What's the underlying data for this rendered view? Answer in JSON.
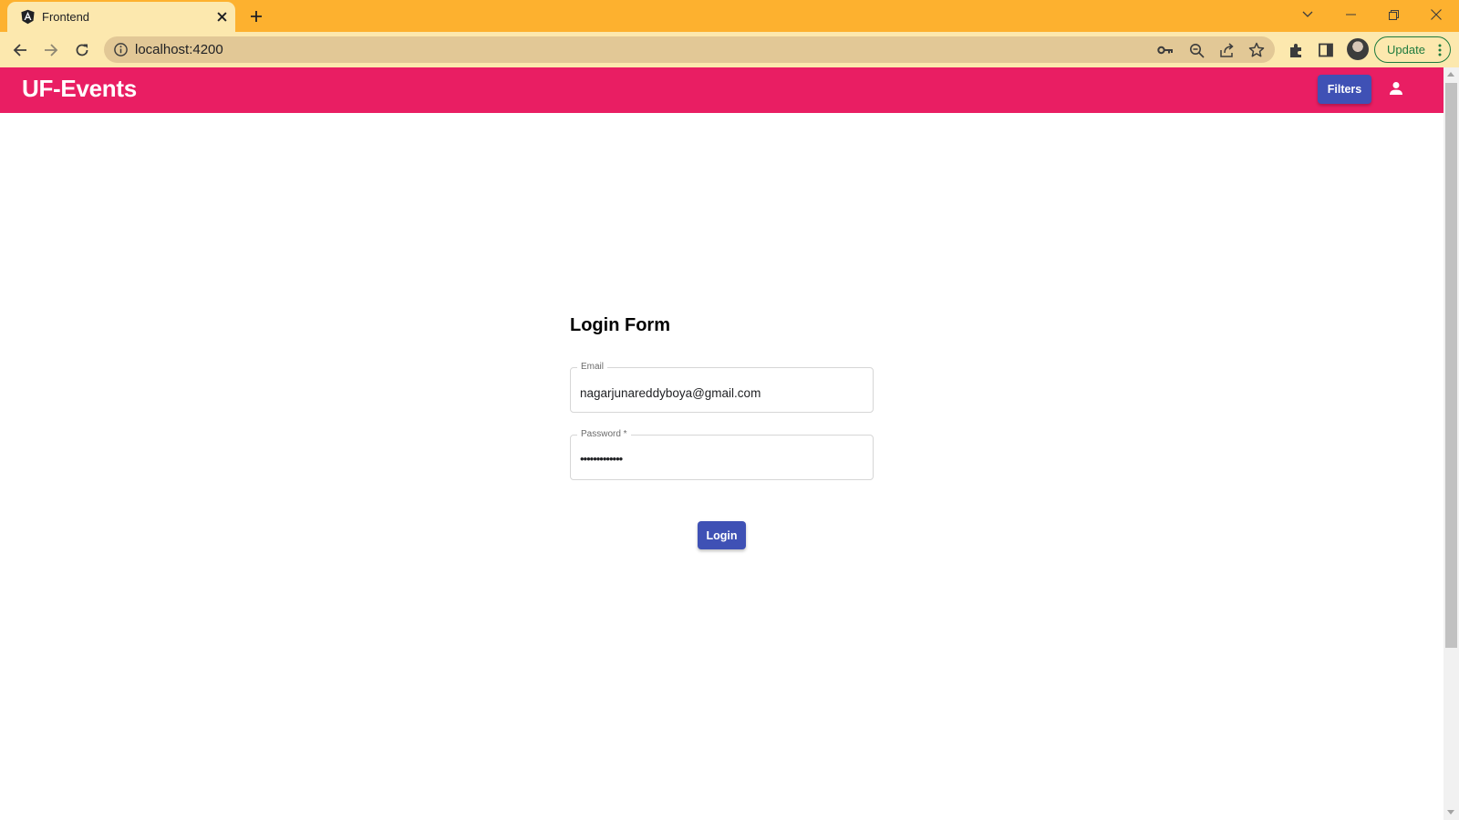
{
  "browser": {
    "tab": {
      "title": "Frontend",
      "favicon": "angular-logo-icon"
    },
    "address": {
      "url": "localhost:4200"
    },
    "update_label": "Update",
    "colors": {
      "tabbar": "#fdb12f",
      "toolbar": "#fce8ae",
      "omnibox": "#e2c896"
    }
  },
  "app": {
    "title": "UF-Events",
    "filters_label": "Filters",
    "account_icon": "person-icon",
    "colors": {
      "header": "#e91e63",
      "primary_button": "#3f51b5"
    }
  },
  "login_form": {
    "title": "Login Form",
    "email": {
      "label": "Email",
      "value": "nagarjunareddyboya@gmail.com"
    },
    "password": {
      "label": "Password *",
      "value": "•••••••••••••"
    },
    "submit_label": "Login"
  }
}
